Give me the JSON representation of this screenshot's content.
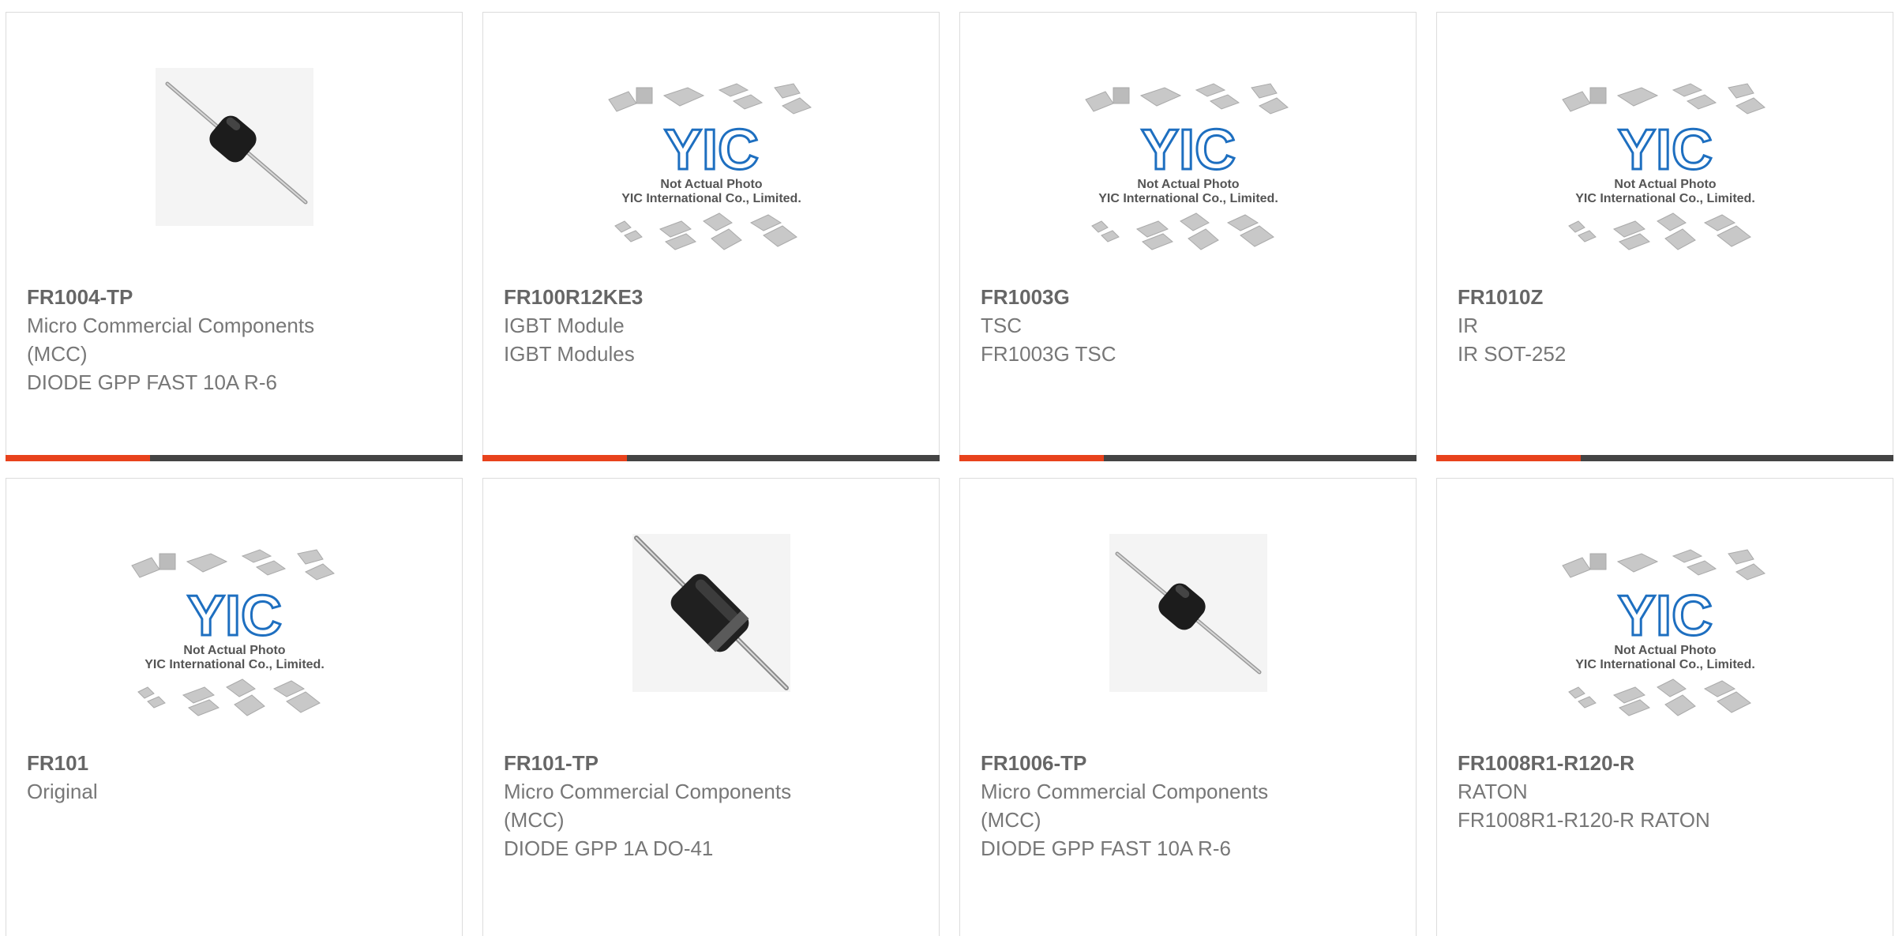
{
  "colors": {
    "accent": "#e8421c",
    "bar": "#444444",
    "title": "#666666",
    "text": "#777777",
    "logo": "#1e6fc0"
  },
  "placeholder": {
    "line1": "Not Actual Photo",
    "line2": "YIC International Co., Limited.",
    "logo_text": "YIC"
  },
  "products": [
    {
      "part": "FR1004-TP",
      "lines": [
        "Micro Commercial Components (MCC)",
        "DIODE GPP FAST 10A R-6"
      ],
      "image": "diode-r6-icon"
    },
    {
      "part": "FR100R12KE3",
      "lines": [
        "IGBT Module",
        "IGBT Modules"
      ],
      "image": "placeholder"
    },
    {
      "part": "FR1003G",
      "lines": [
        "TSC",
        "FR1003G TSC"
      ],
      "image": "placeholder"
    },
    {
      "part": "FR1010Z",
      "lines": [
        "IR",
        "IR SOT-252"
      ],
      "image": "placeholder"
    },
    {
      "part": "FR101",
      "lines": [
        "Original"
      ],
      "image": "placeholder"
    },
    {
      "part": "FR101-TP",
      "lines": [
        "Micro Commercial Components (MCC)",
        "DIODE GPP 1A DO-41"
      ],
      "image": "diode-do41-icon"
    },
    {
      "part": "FR1006-TP",
      "lines": [
        "Micro Commercial Components (MCC)",
        "DIODE GPP FAST 10A R-6"
      ],
      "image": "diode-r6-icon"
    },
    {
      "part": "FR1008R1-R120-R",
      "lines": [
        "RATON",
        "FR1008R1-R120-R RATON"
      ],
      "image": "placeholder"
    }
  ]
}
